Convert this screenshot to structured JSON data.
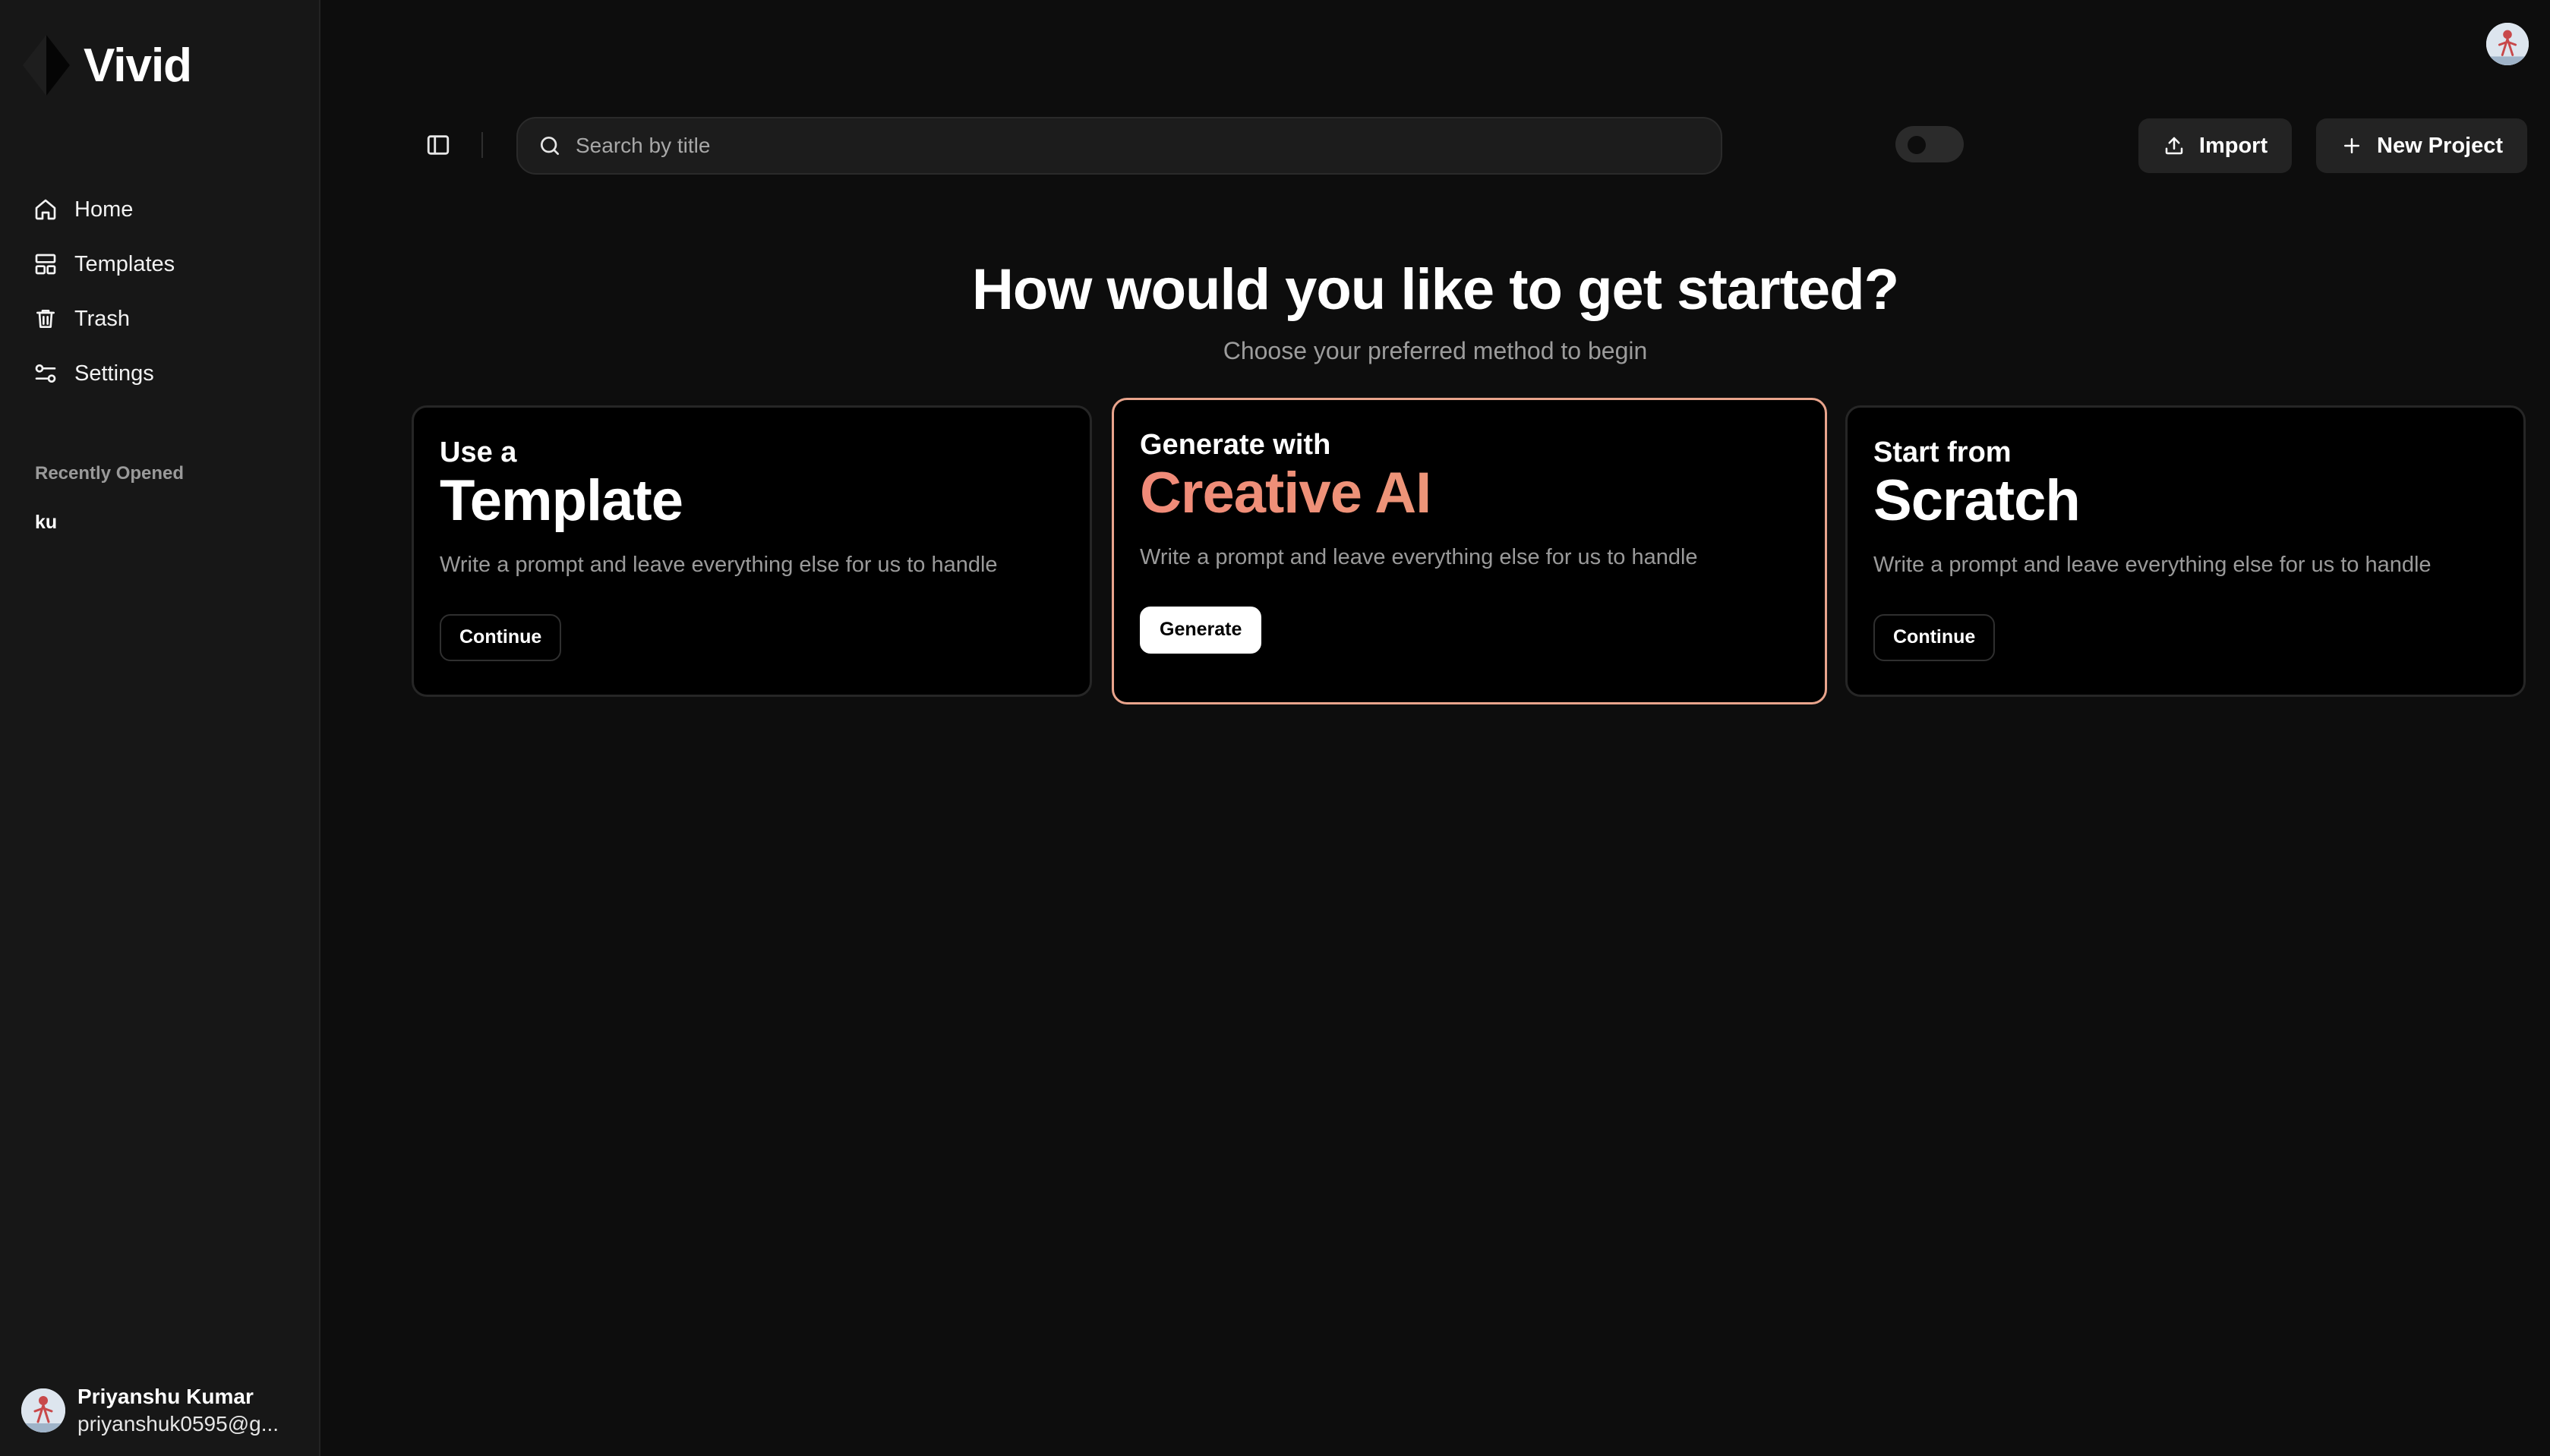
{
  "app": {
    "name": "Vivid",
    "logo_icon": "diamond-leaf-logo"
  },
  "sidebar": {
    "items": [
      {
        "label": "Home",
        "icon": "home-icon"
      },
      {
        "label": "Templates",
        "icon": "layout-icon"
      },
      {
        "label": "Trash",
        "icon": "trash-icon"
      },
      {
        "label": "Settings",
        "icon": "sliders-icon"
      }
    ],
    "recent_title": "Recently Opened",
    "recent_items": [
      "ku"
    ]
  },
  "user": {
    "name": "Priyanshu Kumar",
    "email": "priyanshuk0595@g..."
  },
  "toolbar": {
    "search_placeholder": "Search by title",
    "import_label": "Import",
    "new_project_label": "New Project"
  },
  "hero": {
    "title": "How would you like to get started?",
    "subtitle": "Choose your preferred method to begin"
  },
  "cards": [
    {
      "kicker": "Use a",
      "heading": "Template",
      "description": "Write a prompt and leave everything else for us to handle",
      "button": "Continue"
    },
    {
      "kicker": "Generate with",
      "heading": "Creative AI",
      "description": "Write a prompt and leave everything else for us to handle",
      "button": "Generate"
    },
    {
      "kicker": "Start from",
      "heading": "Scratch",
      "description": "Write a prompt and leave everything else for us to handle",
      "button": "Continue"
    }
  ],
  "colors": {
    "background": "#0d0d0d",
    "sidebar": "#171717",
    "ai_accent_start": "#f08a78",
    "ai_accent_end": "#e8a278"
  }
}
